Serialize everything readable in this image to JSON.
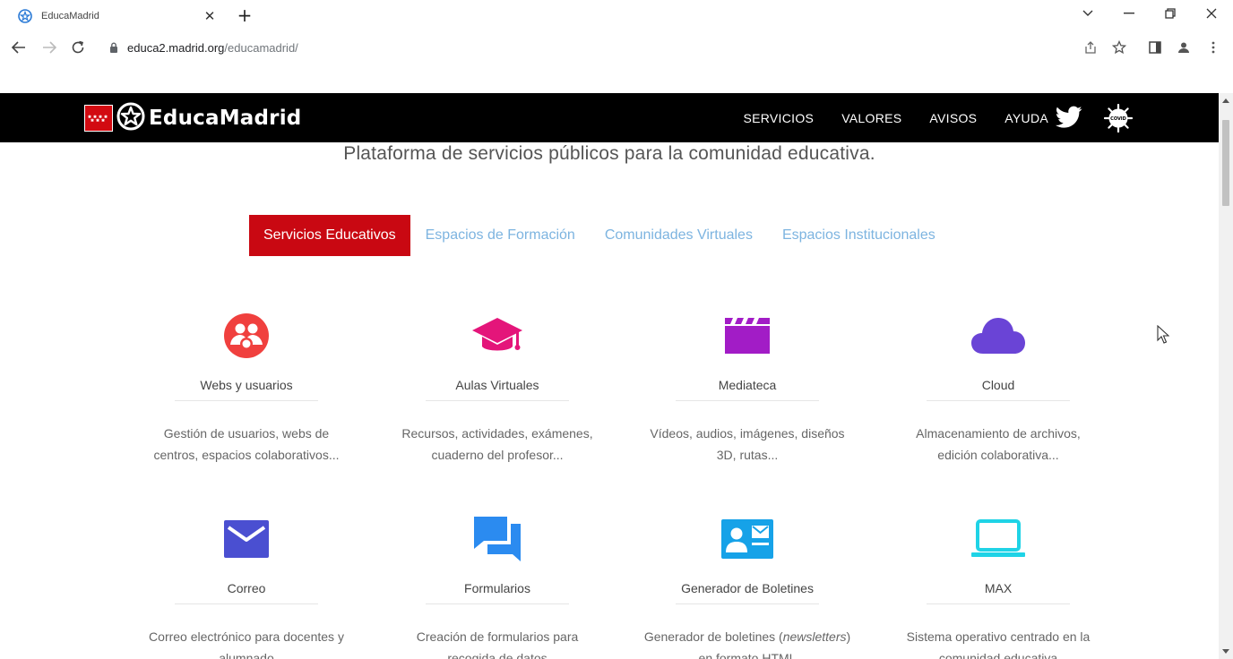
{
  "browser": {
    "tab_title": "EducaMadrid",
    "url_host": "educa2.madrid.org",
    "url_path": "/educamadrid/"
  },
  "header": {
    "logo_text": "EducaMadrid",
    "menu": [
      "SERVICIOS",
      "VALORES",
      "AVISOS",
      "AYUDA"
    ],
    "covid_label": "COVID"
  },
  "tagline": "Plataforma de servicios públicos para la comunidad educativa.",
  "tabs": {
    "active": "Servicios Educativos",
    "others": [
      "Espacios de Formación",
      "Comunidades Virtuales",
      "Espacios Institucionales"
    ]
  },
  "services": [
    {
      "name": "Webs y usuarios",
      "desc1": "Gestión de usuarios, webs de",
      "desc2": "centros, espacios colaborativos...",
      "icon": "users-icon",
      "color": "#f0403e"
    },
    {
      "name": "Aulas Virtuales",
      "desc1": "Recursos, actividades, exámenes,",
      "desc2": "cuaderno del profesor...",
      "icon": "graduation-cap-icon",
      "color": "#e4157a"
    },
    {
      "name": "Mediateca",
      "desc1": "Vídeos, audios, imágenes, diseños",
      "desc2": "3D, rutas...",
      "icon": "clapperboard-icon",
      "color": "#a21cc6"
    },
    {
      "name": "Cloud",
      "desc1": "Almacenamiento de archivos,",
      "desc2": "edición colaborativa...",
      "icon": "cloud-icon",
      "color": "#6a44d6"
    },
    {
      "name": "Correo",
      "desc1": "Correo electrónico para docentes y",
      "desc2": "alumnado",
      "icon": "envelope-icon",
      "color": "#4a4fd1"
    },
    {
      "name": "Formularios",
      "desc1": "Creación de formularios para",
      "desc2": "recogida de datos",
      "icon": "chat-bubbles-icon",
      "color": "#2b8bf0"
    },
    {
      "name": "Generador de Boletines",
      "desc1a": "Generador de boletines (",
      "desc1b": "newsletters",
      "desc1c": ")",
      "desc2": "en formato HTML",
      "icon": "contact-card-icon",
      "color": "#16a2e8"
    },
    {
      "name": "MAX",
      "desc1": "Sistema operativo centrado en la",
      "desc2": "comunidad educativa",
      "icon": "laptop-icon",
      "color": "#1fd3e6"
    }
  ]
}
